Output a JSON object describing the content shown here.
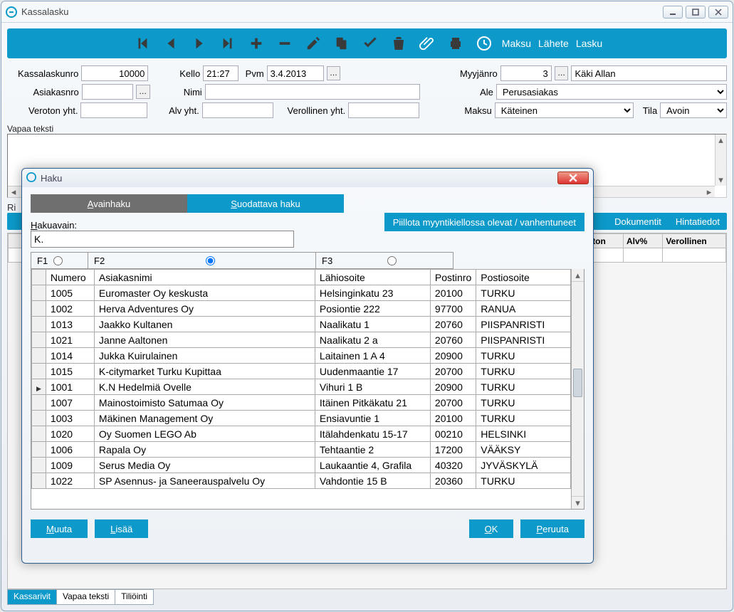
{
  "window": {
    "title": "Kassalasku"
  },
  "toolbar": {
    "maksu": "Maksu",
    "lahete": "Lähete",
    "lasku": "Lasku"
  },
  "form": {
    "kassalaskunro_label": "Kassalaskunro",
    "kassalaskunro": "10000",
    "kello_label": "Kello",
    "kello": "21:27",
    "pvm_label": "Pvm",
    "pvm": "3.4.2013",
    "myyjanro_label": "Myyjänro",
    "myyjanro": "3",
    "myyja_nimi": "Käki Allan",
    "asiakasnro_label": "Asiakasnro",
    "asiakasnro": "",
    "nimi_label": "Nimi",
    "nimi": "",
    "ale_label": "Ale",
    "ale": "Perusasiakas",
    "veroton_label": "Veroton yht.",
    "veroton": "",
    "alv_label": "Alv yht.",
    "alv": "",
    "verollinen_label": "Verollinen yht.",
    "verollinen": "",
    "maksu_label": "Maksu",
    "maksu": "Käteinen",
    "tila_label": "Tila",
    "tila": "Avoin"
  },
  "freetext_label": "Vapaa teksti",
  "rowtabs": {
    "rivi": "Ri",
    "dokumentit": "Dokumentit",
    "hintatiedot": "Hintatiedot"
  },
  "backgrid_headers": {
    "veroton": "eroton",
    "alvp": "Alv%",
    "verollinen": "Verollinen"
  },
  "bottomtabs": {
    "kassarivit": "Kassarivit",
    "vapaateksti": "Vapaa teksti",
    "tiliointi": "Tiliöinti"
  },
  "dialog": {
    "title": "Haku",
    "tabs": {
      "avain": "Avainhaku",
      "suod": "Suodattava haku"
    },
    "hide_btn": "Piillota myyntikiellossa olevat / vanhentuneet",
    "hakuavain_label": "Hakuavain:",
    "hakuavain_value": "K.",
    "fkeys": {
      "f1": "F1",
      "f2": "F2",
      "f3": "F3"
    },
    "cols": {
      "numero": "Numero",
      "nimi": "Asiakasnimi",
      "lahi": "Lähiosoite",
      "postinro": "Postinro",
      "postios": "Postiosoite"
    },
    "rows": [
      {
        "numero": "1005",
        "nimi": "Euromaster Oy keskusta",
        "lahi": "Helsinginkatu 23",
        "postinro": "20100",
        "postios": "TURKU"
      },
      {
        "numero": "1002",
        "nimi": "Herva Adventures Oy",
        "lahi": "Posiontie 222",
        "postinro": "97700",
        "postios": "RANUA"
      },
      {
        "numero": "1013",
        "nimi": "Jaakko Kultanen",
        "lahi": "Naalikatu 1",
        "postinro": "20760",
        "postios": "PIISPANRISTI"
      },
      {
        "numero": "1021",
        "nimi": "Janne Aaltonen",
        "lahi": "Naalikatu 2 a",
        "postinro": "20760",
        "postios": "PIISPANRISTI"
      },
      {
        "numero": "1014",
        "nimi": "Jukka Kuirulainen",
        "lahi": "Laitainen 1 A 4",
        "postinro": "20900",
        "postios": "TURKU"
      },
      {
        "numero": "1015",
        "nimi": "K-citymarket Turku Kupittaa",
        "lahi": "Uudenmaantie 17",
        "postinro": "20700",
        "postios": "TURKU"
      },
      {
        "numero": "1001",
        "nimi": "K.N Hedelmiä Ovelle",
        "lahi": "Vihuri 1 B",
        "postinro": "20900",
        "postios": "TURKU",
        "selected": true
      },
      {
        "numero": "1007",
        "nimi": "Mainostoimisto Satumaa Oy",
        "lahi": "Itäinen Pitkäkatu 21",
        "postinro": "20700",
        "postios": "TURKU"
      },
      {
        "numero": "1003",
        "nimi": "Mäkinen Management Oy",
        "lahi": "Ensiavuntie 1",
        "postinro": "20100",
        "postios": "TURKU"
      },
      {
        "numero": "1020",
        "nimi": "Oy Suomen LEGO Ab",
        "lahi": "Itälahdenkatu 15-17",
        "postinro": "00210",
        "postios": "HELSINKI"
      },
      {
        "numero": "1006",
        "nimi": "Rapala Oy",
        "lahi": "Tehtaantie 2",
        "postinro": "17200",
        "postios": "VÄÄKSY"
      },
      {
        "numero": "1009",
        "nimi": "Serus Media Oy",
        "lahi": "Laukaantie 4, Grafila",
        "postinro": "40320",
        "postios": "JYVÄSKYLÄ"
      },
      {
        "numero": "1022",
        "nimi": "SP Asennus- ja Saneerauspalvelu Oy",
        "lahi": "Vahdontie 15 B",
        "postinro": "20360",
        "postios": "TURKU"
      }
    ],
    "buttons": {
      "muuta": "Muuta",
      "lisaa": "Lisää",
      "ok": "OK",
      "peruuta": "Peruuta"
    }
  }
}
